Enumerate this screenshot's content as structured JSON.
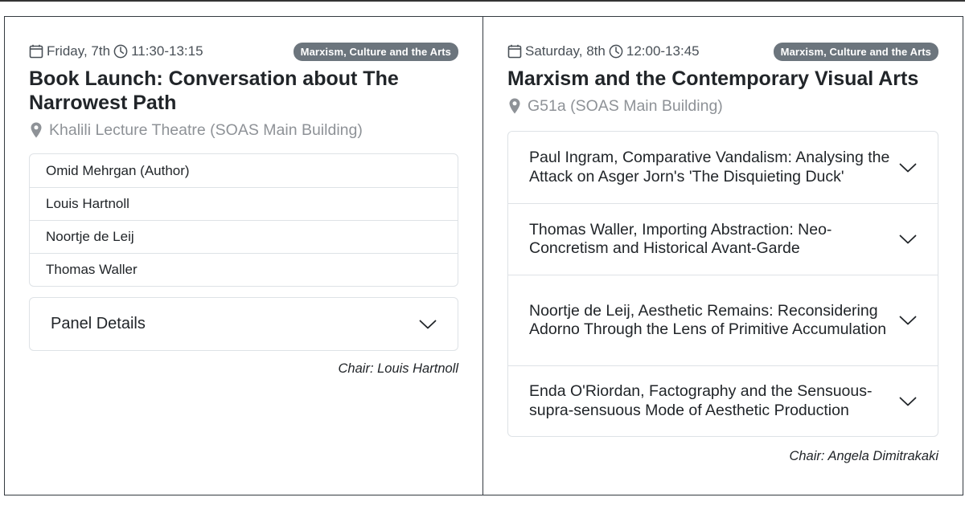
{
  "events": [
    {
      "date": "Friday, 7th",
      "time": "11:30-13:15",
      "badge": "Marxism, Culture and the Arts",
      "title": "Book Launch: Conversation about The Narrowest Path",
      "location": "Khalili Lecture Theatre (SOAS Main Building)",
      "speakers": [
        "Omid Mehrgan (Author)",
        "Louis Hartnoll",
        "Noortje de Leij",
        "Thomas Waller"
      ],
      "panel_details_label": "Panel Details",
      "chair": "Chair: Louis Hartnoll"
    },
    {
      "date": "Saturday, 8th",
      "time": "12:00-13:45",
      "badge": "Marxism, Culture and the Arts",
      "title": "Marxism and the Contemporary Visual Arts",
      "location": "G51a (SOAS Main Building)",
      "papers": [
        "Paul Ingram, Comparative Vandalism: Analysing the Attack on Asger Jorn's 'The Disquieting Duck'",
        "Thomas Waller, Importing Abstraction: Neo-Concretism and Historical Avant-Garde",
        "Noortje de Leij, Aesthetic Remains: Reconsidering Adorno Through the Lens of Primitive Accumulation",
        "Enda O'Riordan, Factography and the Sensuous-supra-sensuous Mode of Aesthetic Production"
      ],
      "chair": "Chair: Angela Dimitrakaki"
    }
  ],
  "icons": {
    "date": "calendar-icon",
    "time": "clock-icon",
    "location": "map-pin-icon",
    "expand": "chevron-down-icon"
  },
  "colors": {
    "badge_bg": "#6c757d",
    "location_text": "#8e9297",
    "border": "#dee2e6"
  }
}
